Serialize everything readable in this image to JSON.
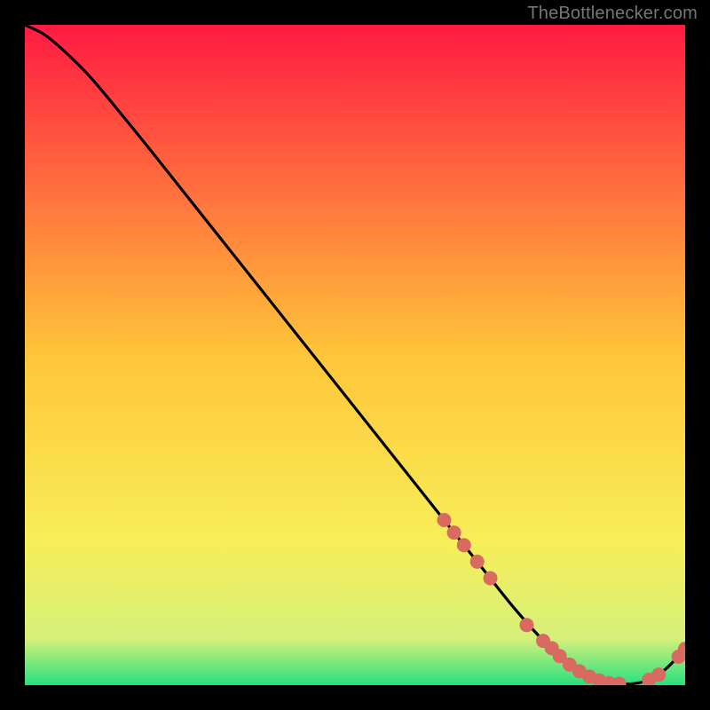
{
  "attribution": "TheBottlenecker.com",
  "chart_data": {
    "type": "line",
    "title": "",
    "xlabel": "",
    "ylabel": "",
    "xlim": [
      0,
      100
    ],
    "ylim": [
      0,
      100
    ],
    "background_gradient": {
      "stops": [
        {
          "pct": 0,
          "color": "#ff1a42"
        },
        {
          "pct": 50,
          "color": "#ffc53a"
        },
        {
          "pct": 78,
          "color": "#f8ee58"
        },
        {
          "pct": 93,
          "color": "#d5f07a"
        },
        {
          "pct": 100,
          "color": "#27e07f"
        }
      ]
    },
    "series": [
      {
        "name": "curve",
        "x": [
          0,
          3,
          6,
          10,
          15,
          20,
          30,
          40,
          50,
          60,
          65,
          70,
          74,
          78,
          82,
          86,
          90,
          94,
          97,
          100
        ],
        "y": [
          100,
          98.5,
          96,
          92,
          86,
          79.8,
          67.2,
          54.6,
          42.0,
          29.4,
          23.1,
          16.8,
          11.8,
          7.3,
          3.6,
          1.2,
          0.2,
          0.6,
          2.4,
          5.5
        ],
        "color": "#000000"
      }
    ],
    "markers": {
      "name": "highlight-dots",
      "color": "#d86a62",
      "radius_px": 8,
      "points_xy": [
        [
          63.5,
          25.0
        ],
        [
          65.0,
          23.1
        ],
        [
          66.5,
          21.2
        ],
        [
          68.5,
          18.7
        ],
        [
          70.5,
          16.2
        ],
        [
          76.0,
          9.1
        ],
        [
          78.5,
          6.7
        ],
        [
          79.8,
          5.6
        ],
        [
          81.0,
          4.4
        ],
        [
          82.5,
          3.1
        ],
        [
          84.0,
          2.1
        ],
        [
          85.5,
          1.3
        ],
        [
          87.0,
          0.7
        ],
        [
          88.5,
          0.3
        ],
        [
          90.0,
          0.2
        ],
        [
          94.5,
          0.8
        ],
        [
          96.0,
          1.6
        ],
        [
          99.0,
          4.3
        ],
        [
          100.0,
          5.5
        ]
      ]
    }
  }
}
